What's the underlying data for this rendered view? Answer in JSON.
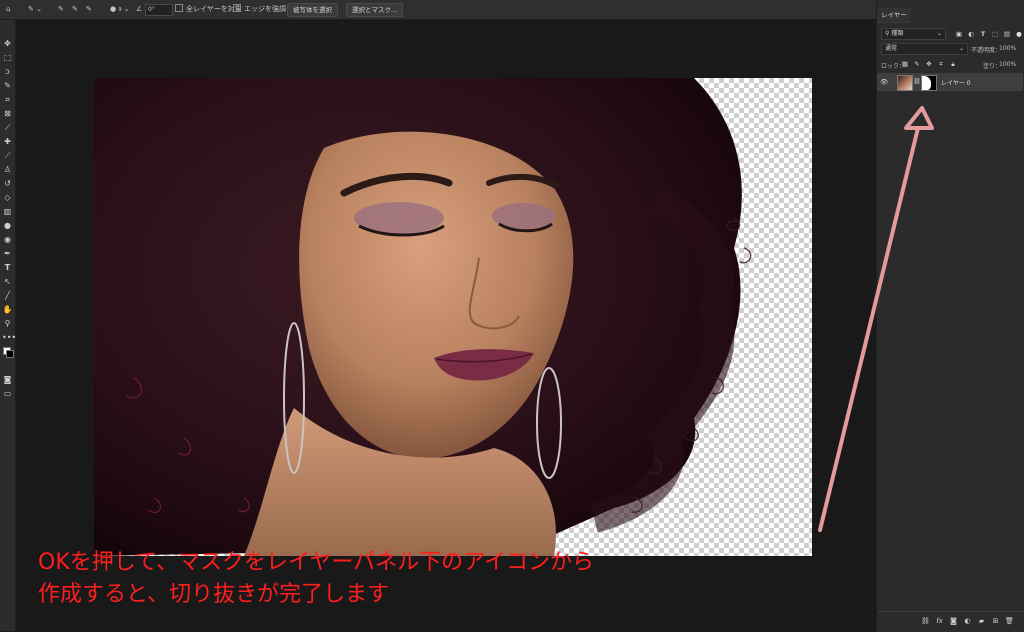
{
  "options_bar": {
    "home_icon": "home-icon",
    "angle_value": "0°",
    "brush_size": "9",
    "sample_all_layers": "全レイヤーを対象",
    "enhance_edge": "エッジを強調",
    "select_subject": "被写体を選択",
    "select_and_mask": "選択とマスク..."
  },
  "layers_panel": {
    "tab_label": "レイヤー",
    "kind_filter": "種類",
    "blend_mode": "通常",
    "opacity_label": "不透明度：",
    "opacity_value": "100%",
    "lock_label": "ロック：",
    "fill_label": "塗り：",
    "fill_value": "100%",
    "layer_name": "レイヤー 0",
    "bottom_fx": "fx"
  },
  "caption": {
    "line1": "OKを押して、マスクをレイヤーパネル下のアイコンから",
    "line2": "作成すると、切り抜きが完了します"
  },
  "colors": {
    "annotation_arrow": "#e29a9a",
    "caption_text": "#ff1e1e",
    "panel_bg": "#2b2b2b",
    "canvas_bg": "#191919"
  }
}
